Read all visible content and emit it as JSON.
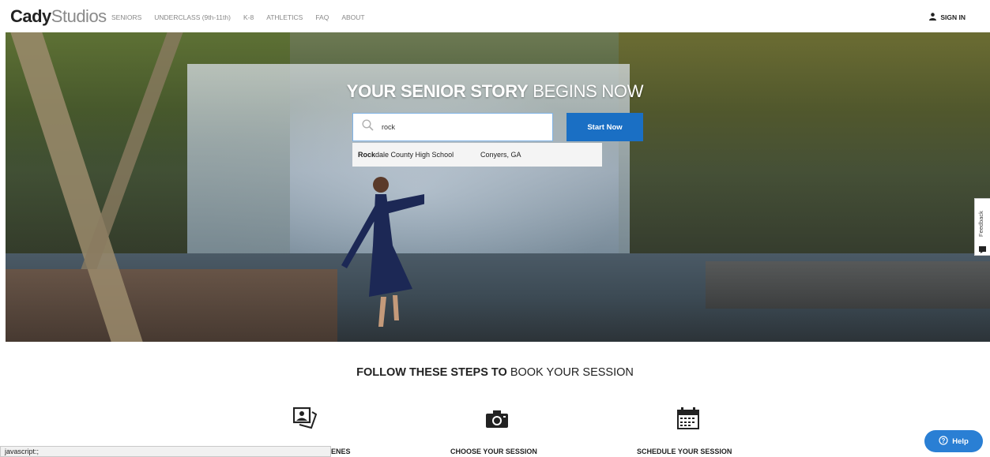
{
  "logo": {
    "bold": "Cady",
    "light": "Studios"
  },
  "nav": {
    "items": [
      {
        "label": "SENIORS"
      },
      {
        "label": "UNDERCLASS (9th-11th)"
      },
      {
        "label": "K-8"
      },
      {
        "label": "ATHLETICS"
      },
      {
        "label": "FAQ"
      },
      {
        "label": "ABOUT"
      }
    ]
  },
  "header": {
    "signin_label": "SIGN IN",
    "signin_icon": "user-icon"
  },
  "hero": {
    "headline_strong": "YOUR SENIOR STORY",
    "headline_light": "BEGINS NOW",
    "search_value": "rock",
    "search_icon": "search-icon",
    "start_button": "Start Now",
    "suggestion": {
      "match": "Rock",
      "rest": "dale County High School",
      "location": "Conyers, GA"
    }
  },
  "feedback": {
    "label": "Feedback",
    "icon": "feedback-icon"
  },
  "steps": {
    "title_strong": "FOLLOW THESE STEPS TO",
    "title_light": "BOOK YOUR SESSION",
    "items": [
      {
        "label": "ENES",
        "icon": "photos-icon"
      },
      {
        "label": "CHOOSE YOUR SESSION",
        "icon": "camera-icon"
      },
      {
        "label": "SCHEDULE YOUR SESSION",
        "icon": "calendar-icon"
      }
    ]
  },
  "statusbar": {
    "text": "javascript:;"
  },
  "help": {
    "label": "Help",
    "icon": "help-icon"
  },
  "colors": {
    "accent": "#1a6fc4",
    "help": "#2a7fd4"
  }
}
